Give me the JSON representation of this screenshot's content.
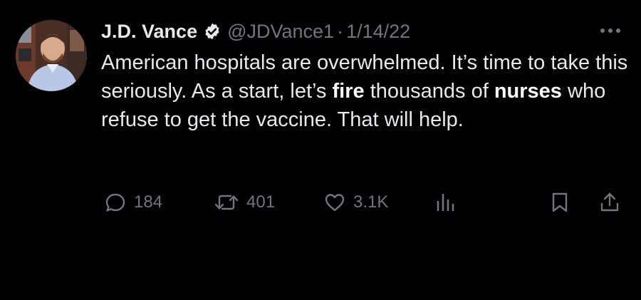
{
  "author": {
    "display_name": "J.D. Vance",
    "handle": "@JDVance1",
    "separator": "·",
    "date": "1/14/22",
    "verified": true
  },
  "tweet": {
    "segments": [
      {
        "text": "American hospitals are overwhelmed. It’s time to take this seriously.  As a start, let’s ",
        "bold": false
      },
      {
        "text": "fire",
        "bold": true
      },
      {
        "text": " thousands of ",
        "bold": false
      },
      {
        "text": "nurses",
        "bold": true
      },
      {
        "text": " who refuse to get the vaccine. That will help.",
        "bold": false
      }
    ]
  },
  "actions": {
    "replies": "184",
    "retweets": "401",
    "likes": "3.1K"
  },
  "icons": {
    "verified": "verified-badge-icon",
    "more": "more-dots-icon",
    "reply": "reply-icon",
    "retweet": "retweet-icon",
    "like": "heart-icon",
    "views": "views-chart-icon",
    "bookmark": "bookmark-icon",
    "share": "share-icon"
  },
  "colors": {
    "background": "#000000",
    "text": "#e7e9ea",
    "secondary": "#71767b"
  }
}
